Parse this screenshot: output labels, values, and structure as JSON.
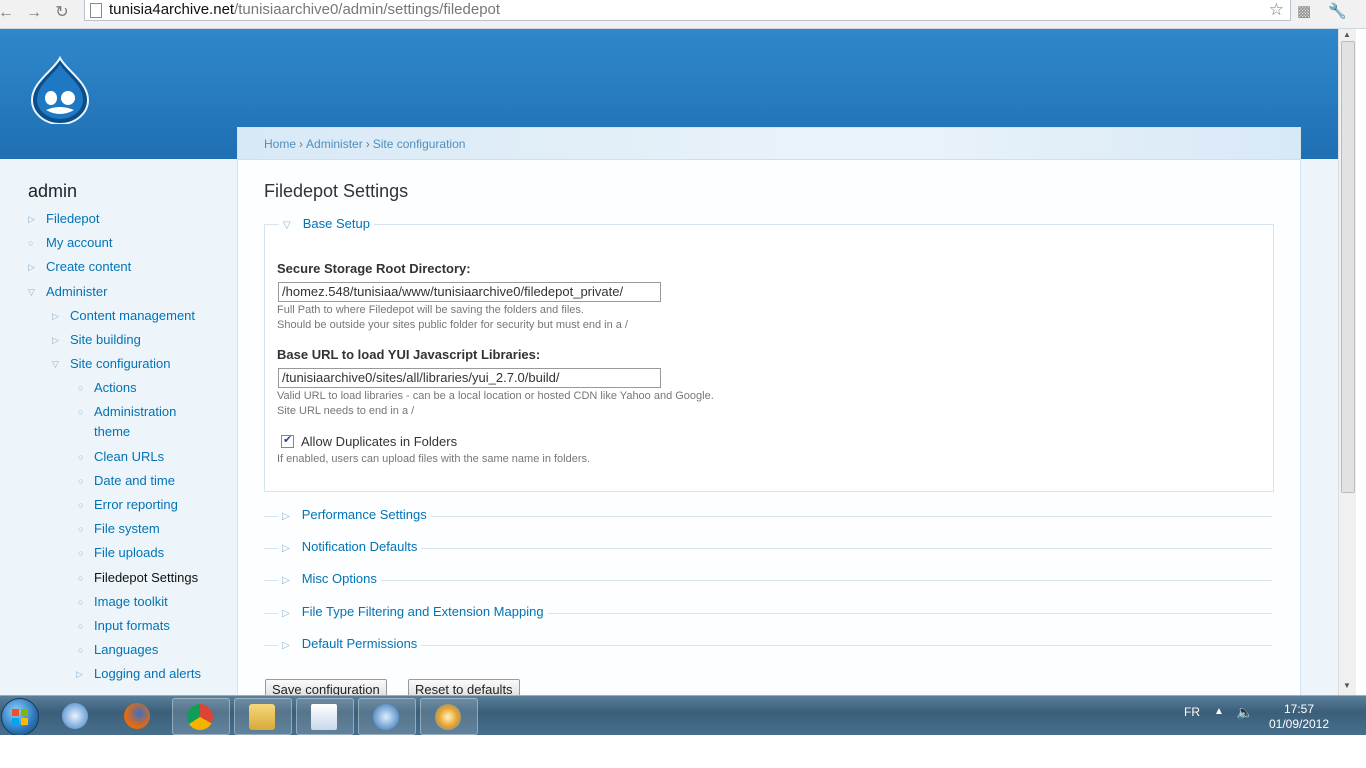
{
  "browser": {
    "url_host": "tunisia4archive.net",
    "url_path": "/tunisiaarchive0/admin/settings/filedepot"
  },
  "sidebar": {
    "title": "admin",
    "items": [
      {
        "label": "Filedepot"
      },
      {
        "label": "My account"
      },
      {
        "label": "Create content"
      },
      {
        "label": "Administer"
      },
      {
        "label": "Content management"
      },
      {
        "label": "Site building"
      },
      {
        "label": "Site configuration"
      },
      {
        "label": "Actions"
      },
      {
        "label": "Administration"
      },
      {
        "label": "theme"
      },
      {
        "label": "Clean URLs"
      },
      {
        "label": "Date and time"
      },
      {
        "label": "Error reporting"
      },
      {
        "label": "File system"
      },
      {
        "label": "File uploads"
      },
      {
        "label": "Filedepot Settings"
      },
      {
        "label": "Image toolkit"
      },
      {
        "label": "Input formats"
      },
      {
        "label": "Languages"
      },
      {
        "label": "Logging and alerts"
      }
    ]
  },
  "breadcrumb": {
    "items": [
      "Home",
      "Administer",
      "Site configuration"
    ],
    "separator": "›"
  },
  "main": {
    "title": "Filedepot Settings",
    "base_setup": {
      "legend": "Base Setup",
      "storage_label": "Secure Storage Root Directory:",
      "storage_value": "/homez.548/tunisiaa/www/tunisiaarchive0/filedepot_private/",
      "storage_desc1": "Full Path to where Filedepot will be saving the folders and files.",
      "storage_desc2": "Should be outside your sites public folder for security but must end in a /",
      "yui_label": "Base URL to load YUI Javascript Libraries:",
      "yui_value": "/tunisiaarchive0/sites/all/libraries/yui_2.7.0/build/",
      "yui_desc1": "Valid URL to load libraries - can be a local location or hosted CDN like Yahoo and Google.",
      "yui_desc2": "Site URL needs to end in a /",
      "dup_label": "Allow Duplicates in Folders",
      "dup_desc": "If enabled, users can upload files with the same name in folders."
    },
    "sections": [
      {
        "legend": "Performance Settings"
      },
      {
        "legend": "Notification Defaults"
      },
      {
        "legend": "Misc Options"
      },
      {
        "legend": "File Type Filtering and Extension Mapping"
      },
      {
        "legend": "Default Permissions"
      }
    ],
    "save_label": "Save configuration",
    "reset_label": "Reset to defaults"
  },
  "taskbar": {
    "lang": "FR",
    "time": "17:57",
    "date": "01/09/2012"
  },
  "colors": {
    "link": "#0273b6",
    "header": "#2f88cb"
  }
}
